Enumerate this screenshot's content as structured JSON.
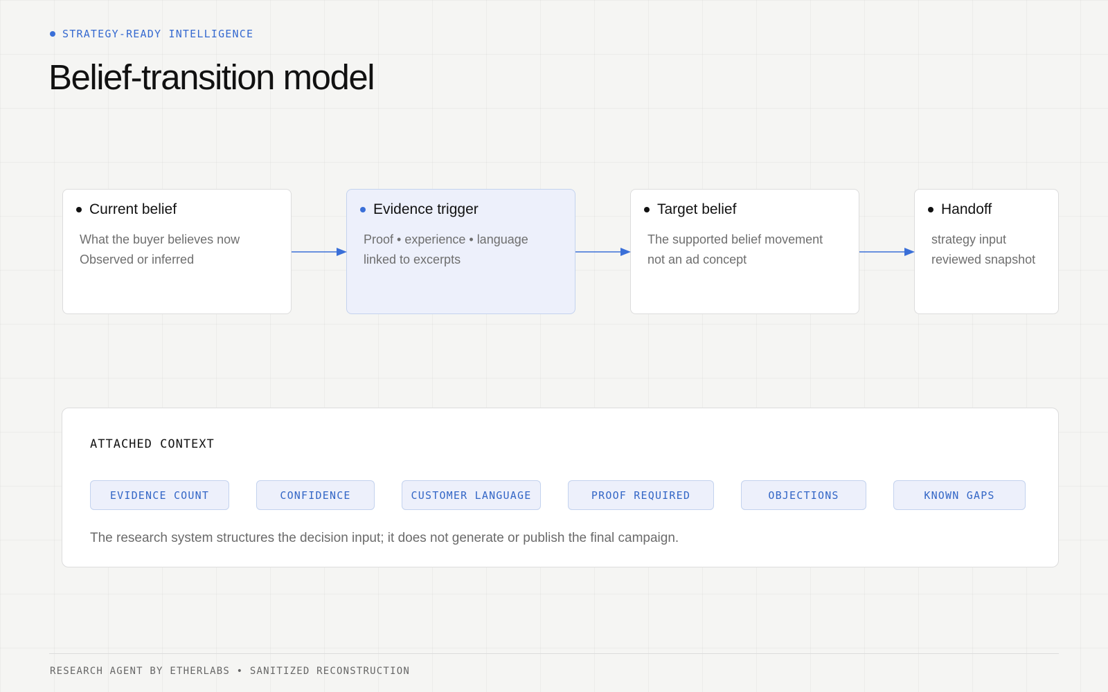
{
  "eyebrow": "STRATEGY-READY INTELLIGENCE",
  "title": "Belief-transition model",
  "steps": [
    {
      "title": "Current belief",
      "lines": [
        "What the buyer believes now",
        "Observed or inferred"
      ]
    },
    {
      "title": "Evidence trigger",
      "lines": [
        "Proof • experience • language",
        "linked to excerpts"
      ]
    },
    {
      "title": "Target belief",
      "lines": [
        "The supported belief movement",
        "not an ad concept"
      ]
    },
    {
      "title": "Handoff",
      "lines": [
        "strategy input",
        "reviewed snapshot"
      ]
    }
  ],
  "context": {
    "label": "ATTACHED CONTEXT",
    "tags": [
      "EVIDENCE COUNT",
      "CONFIDENCE",
      "CUSTOMER LANGUAGE",
      "PROOF REQUIRED",
      "OBJECTIONS",
      "KNOWN GAPS"
    ],
    "note": "The research system structures the decision input; it does not generate or publish the final campaign."
  },
  "footer": "RESEARCH AGENT BY ETHERLABS • SANITIZED RECONSTRUCTION",
  "colors": {
    "accent": "#3a6fd8",
    "highlight_fill": "#edf0fb",
    "highlight_border": "#c3d2ee",
    "card_border": "#dcdcdc",
    "background": "#f5f5f3"
  },
  "icons": {
    "step_bullet": "dot",
    "connector": "arrow-right"
  }
}
